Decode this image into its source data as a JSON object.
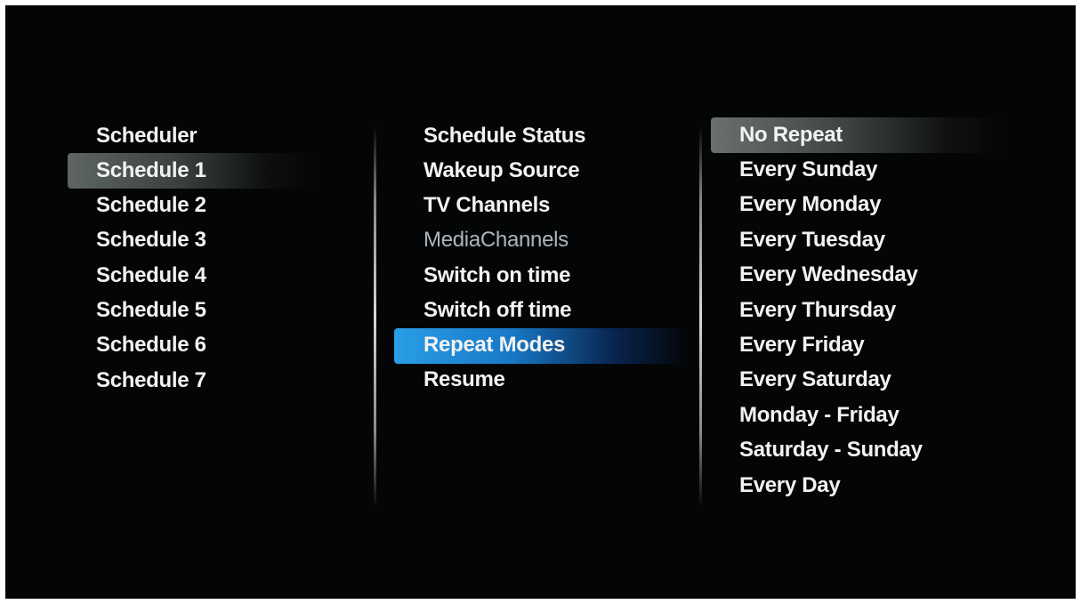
{
  "schedule_list": {
    "items": [
      {
        "label": "Scheduler"
      },
      {
        "label": "Schedule 1"
      },
      {
        "label": "Schedule 2"
      },
      {
        "label": "Schedule 3"
      },
      {
        "label": "Schedule 4"
      },
      {
        "label": "Schedule 5"
      },
      {
        "label": "Schedule 6"
      },
      {
        "label": "Schedule 7"
      }
    ],
    "selected": "Schedule 1"
  },
  "settings_list": {
    "items": [
      {
        "label": "Schedule Status"
      },
      {
        "label": "Wakeup Source"
      },
      {
        "label": "TV Channels"
      },
      {
        "label": "MediaChannels"
      },
      {
        "label": "Switch on time"
      },
      {
        "label": "Switch off time"
      },
      {
        "label": "Repeat Modes"
      },
      {
        "label": "Resume"
      }
    ],
    "selected": "Repeat Modes",
    "disabled": [
      "MediaChannels"
    ]
  },
  "repeat_modes_list": {
    "items": [
      {
        "label": "No Repeat"
      },
      {
        "label": "Every Sunday"
      },
      {
        "label": "Every Monday"
      },
      {
        "label": "Every Tuesday"
      },
      {
        "label": "Every Wednesday"
      },
      {
        "label": "Every Thursday"
      },
      {
        "label": "Every Friday"
      },
      {
        "label": "Every Saturday"
      },
      {
        "label": "Monday - Friday"
      },
      {
        "label": "Saturday - Sunday"
      },
      {
        "label": "Every Day"
      }
    ],
    "selected": "No Repeat"
  },
  "colors": {
    "background": "#040506",
    "text": "#f2f2f2",
    "dim_text": "#a9b7bb",
    "focus_highlight": "#1f8ad8",
    "selection_highlight": "#5e6663"
  }
}
